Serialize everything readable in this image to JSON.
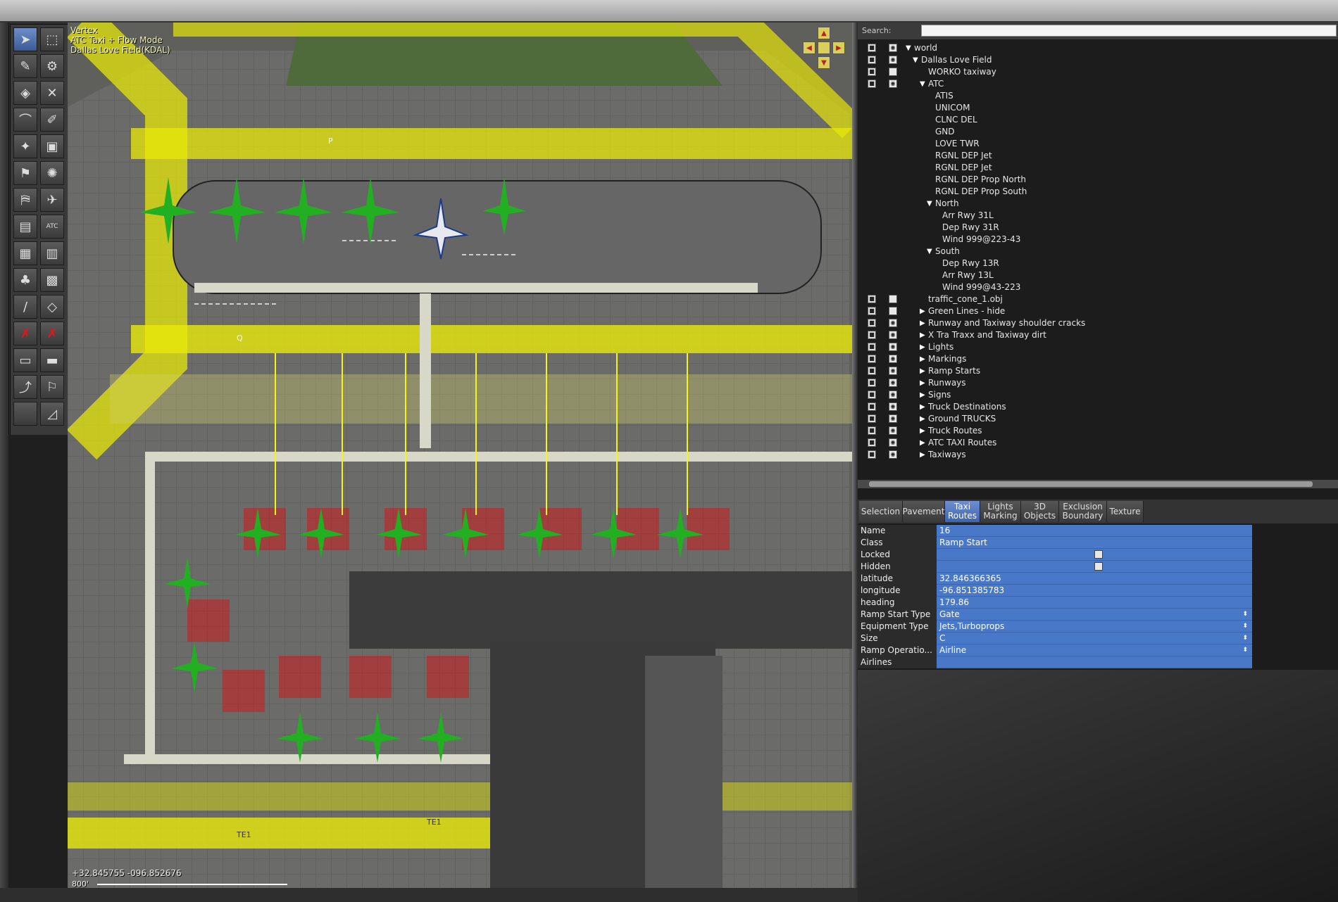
{
  "map_hud": {
    "line1": "Vertex",
    "line2": "ATC Taxi + Flow Mode",
    "line3": "Dallas Love Field(KDAL)"
  },
  "map_footer": {
    "coords": "+32.845755 -096.852676",
    "scale": "800'"
  },
  "map_labels": {
    "te1": "TE1",
    "te1b": "TE1",
    "p": "P",
    "q": "Q"
  },
  "toolbar": {
    "tools": [
      "select-arrow",
      "marquee",
      "pen",
      "pushback",
      "paint",
      "no-pen",
      "curve",
      "edit",
      "light",
      "sign",
      "windsock",
      "beacon",
      "gate",
      "plane",
      "marking",
      "atc",
      "grid",
      "tiles",
      "tree",
      "forest",
      "line",
      "poly",
      "delete",
      "delete2",
      "truck",
      "truck2",
      "route",
      "flag",
      "blank",
      "blank2"
    ]
  },
  "search": {
    "label": "Search:",
    "value": ""
  },
  "tree": {
    "rows": [
      {
        "label": "world",
        "depth": 0,
        "twisty": "▼",
        "lock": true,
        "eye": true
      },
      {
        "label": "Dallas Love Field",
        "depth": 1,
        "twisty": "▼",
        "lock": true,
        "eye": true
      },
      {
        "label": "WORKO taxiway",
        "depth": 2,
        "twisty": "",
        "lock": true,
        "eye": false
      },
      {
        "label": "ATC",
        "depth": 2,
        "twisty": "▼",
        "lock": true,
        "eye": true
      },
      {
        "label": "ATIS",
        "depth": 3,
        "twisty": ""
      },
      {
        "label": "UNICOM",
        "depth": 3,
        "twisty": ""
      },
      {
        "label": "CLNC DEL",
        "depth": 3,
        "twisty": ""
      },
      {
        "label": "GND",
        "depth": 3,
        "twisty": ""
      },
      {
        "label": "LOVE TWR",
        "depth": 3,
        "twisty": ""
      },
      {
        "label": "RGNL DEP Jet",
        "depth": 3,
        "twisty": ""
      },
      {
        "label": "RGNL DEP Jet",
        "depth": 3,
        "twisty": ""
      },
      {
        "label": "RGNL DEP Prop North",
        "depth": 3,
        "twisty": ""
      },
      {
        "label": "RGNL DEP Prop South",
        "depth": 3,
        "twisty": ""
      },
      {
        "label": "North",
        "depth": 3,
        "twisty": "▼"
      },
      {
        "label": "Arr Rwy 31L",
        "depth": 4,
        "twisty": ""
      },
      {
        "label": "Dep Rwy 31R",
        "depth": 4,
        "twisty": ""
      },
      {
        "label": "Wind 999@223-43",
        "depth": 4,
        "twisty": ""
      },
      {
        "label": "South",
        "depth": 3,
        "twisty": "▼"
      },
      {
        "label": "Dep Rwy 13R",
        "depth": 4,
        "twisty": ""
      },
      {
        "label": "Arr Rwy 13L",
        "depth": 4,
        "twisty": ""
      },
      {
        "label": "Wind 999@43-223",
        "depth": 4,
        "twisty": ""
      },
      {
        "label": "traffic_cone_1.obj",
        "depth": 2,
        "twisty": "",
        "lock": true,
        "eye": false
      },
      {
        "label": "Green Lines - hide",
        "depth": 2,
        "twisty": "▶",
        "lock": true,
        "eye": false
      },
      {
        "label": "Runway and Taxiway shoulder cracks",
        "depth": 2,
        "twisty": "▶",
        "lock": true,
        "eye": true
      },
      {
        "label": "X Tra Traxx and Taxiway dirt",
        "depth": 2,
        "twisty": "▶",
        "lock": true,
        "eye": true
      },
      {
        "label": "Lights",
        "depth": 2,
        "twisty": "▶",
        "lock": true,
        "eye": true
      },
      {
        "label": "Markings",
        "depth": 2,
        "twisty": "▶",
        "lock": true,
        "eye": true
      },
      {
        "label": "Ramp Starts",
        "depth": 2,
        "twisty": "▶",
        "lock": true,
        "eye": true
      },
      {
        "label": "Runways",
        "depth": 2,
        "twisty": "▶",
        "lock": true,
        "eye": true
      },
      {
        "label": "Signs",
        "depth": 2,
        "twisty": "▶",
        "lock": true,
        "eye": true
      },
      {
        "label": "Truck Destinations",
        "depth": 2,
        "twisty": "▶",
        "lock": true,
        "eye": true
      },
      {
        "label": "Ground TRUCKS",
        "depth": 2,
        "twisty": "▶",
        "lock": true,
        "eye": true
      },
      {
        "label": "Truck Routes",
        "depth": 2,
        "twisty": "▶",
        "lock": true,
        "eye": true
      },
      {
        "label": "ATC TAXI Routes",
        "depth": 2,
        "twisty": "▶",
        "lock": true,
        "eye": true
      },
      {
        "label": "Taxiways",
        "depth": 2,
        "twisty": "▶",
        "lock": true,
        "eye": true
      }
    ]
  },
  "tabs": [
    {
      "label": "Selection",
      "active": false
    },
    {
      "label": "Pavement",
      "active": false
    },
    {
      "label": "Taxi Routes",
      "active": true
    },
    {
      "label": "Lights Marking",
      "active": false
    },
    {
      "label": "3D Objects",
      "active": false
    },
    {
      "label": "Exclusion Boundary",
      "active": false
    },
    {
      "label": "Texture",
      "active": false
    }
  ],
  "properties": [
    {
      "key": "Name",
      "value": "16",
      "kind": "text"
    },
    {
      "key": "Class",
      "value": "Ramp Start",
      "kind": "text"
    },
    {
      "key": "Locked",
      "value": "",
      "kind": "check"
    },
    {
      "key": "Hidden",
      "value": "",
      "kind": "check"
    },
    {
      "key": "latitude",
      "value": " 32.846366365",
      "kind": "text"
    },
    {
      "key": "longitude",
      "value": " -96.851385783",
      "kind": "text"
    },
    {
      "key": "heading",
      "value": "179.86",
      "kind": "text"
    },
    {
      "key": "Ramp Start Type",
      "value": "Gate",
      "kind": "select"
    },
    {
      "key": "Equipment Type",
      "value": "Jets,Turboprops",
      "kind": "select"
    },
    {
      "key": "Size",
      "value": "C",
      "kind": "select"
    },
    {
      "key": "Ramp Operatio...",
      "value": "Airline",
      "kind": "select"
    },
    {
      "key": "Airlines",
      "value": "",
      "kind": "text"
    }
  ],
  "colors": {
    "selection_blue": "#4a78c8",
    "tab_active": "#4f72bd",
    "taxiway_yellow": "#f2f20a",
    "ramp_green": "#1fb21f",
    "ramp_red": "#d42020"
  }
}
